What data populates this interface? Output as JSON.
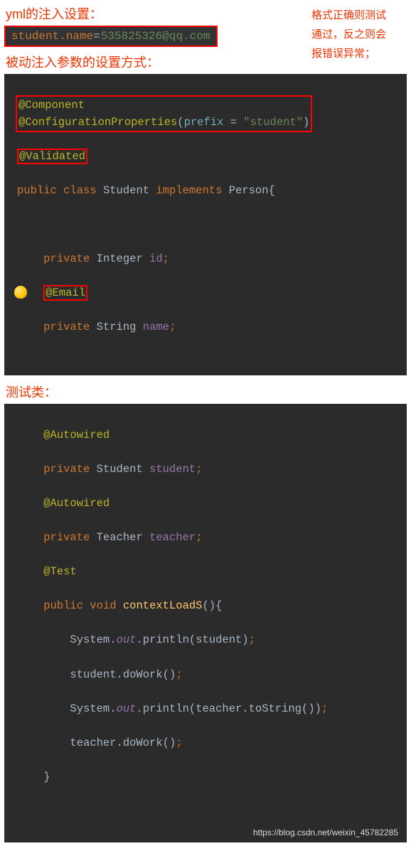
{
  "heading1": "yml的注入设置：",
  "side_note_l1": "格式正确则测试",
  "side_note_l2": "通过，反之则会",
  "side_note_l3": "报错误异常；",
  "yml": {
    "key": "student.name",
    "eq": "=",
    "val": "535825326@qq.com"
  },
  "heading2": "被动注入参数的设置方式：",
  "code1": {
    "at_component": "@Component",
    "at_cfgprops": "@ConfigurationProperties",
    "paren_open": "(",
    "prefix_key": "prefix ",
    "eq": "= ",
    "prefix_val": "\"student\"",
    "paren_close": ")",
    "at_validated": "@Validated",
    "kw_public": "public ",
    "kw_class": "class ",
    "cls_name": "Student ",
    "kw_implements": "implements ",
    "iface": "Person",
    "brace": "{",
    "kw_private1": "private ",
    "type_int": "Integer ",
    "fld_id": "id",
    "semi": ";",
    "at_email": "@Email",
    "kw_private2": "private ",
    "type_str": "String ",
    "fld_name": "name"
  },
  "heading3": "测试类：",
  "code2": {
    "at_autowired1": "@Autowired",
    "kw_private1": "private ",
    "type_student": "Student ",
    "fld_student": "student",
    "semi": ";",
    "at_autowired2": "@Autowired",
    "kw_private2": "private ",
    "type_teacher": "Teacher ",
    "fld_teacher": "teacher",
    "at_test": "@Test",
    "kw_public": "public ",
    "kw_void": "void ",
    "method": "contextLoadS",
    "parens": "()",
    "brace_o": "{",
    "sys": "System.",
    "out": "out",
    "dot": ".",
    "println": "println",
    "arg_student": "(student)",
    "stu_dowork": "student.doWork()",
    "arg_teacher_tostr": "(teacher.toString())",
    "tch_dowork": "teacher.doWork()",
    "brace_c": "}"
  },
  "watermark": "https://blog.csdn.net/weixin_45782285"
}
